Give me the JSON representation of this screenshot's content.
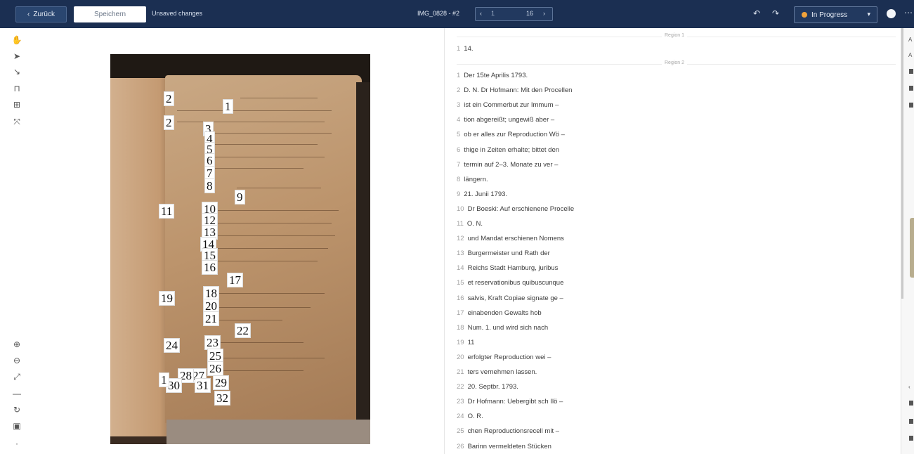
{
  "topbar": {
    "back_label": "Zurück",
    "save_label": "Speichern",
    "unsaved_text": "Unsaved changes",
    "doc_title": "IMG_0828 - #2",
    "pager_prev": "‹",
    "pager_page": "1",
    "pager_total": "16",
    "pager_next": "›",
    "status_label": "In Progress"
  },
  "canvas": {
    "region_numbers": [
      "1",
      "2",
      "2",
      "3",
      "4",
      "5",
      "6",
      "7",
      "8",
      "9",
      "10",
      "11",
      "12",
      "13",
      "14",
      "15",
      "16",
      "17",
      "18",
      "19",
      "20",
      "21",
      "22",
      "23",
      "24",
      "25",
      "26",
      "27",
      "28",
      "29",
      "30",
      "31",
      "32",
      "1"
    ]
  },
  "transcript": {
    "region1_label": "Region 1",
    "region2_label": "Region 2",
    "region1_lines": [
      {
        "n": "1",
        "text": "14."
      }
    ],
    "region2_lines": [
      {
        "n": "1",
        "text": "Der 15te Aprilis 1793."
      },
      {
        "n": "2",
        "text": "D. N. Dr Hofmann: Mit den Procellen"
      },
      {
        "n": "3",
        "text": "ist ein Commerbut zur Immum –"
      },
      {
        "n": "4",
        "text": "tion abgereißt; ungewiß aber –"
      },
      {
        "n": "5",
        "text": "ob er alles zur Reproduction Wö –"
      },
      {
        "n": "6",
        "text": "thige in Zeiten erhalte; bittet den"
      },
      {
        "n": "7",
        "text": "termin auf 2–3. Monate zu ver –"
      },
      {
        "n": "8",
        "text": "längern."
      },
      {
        "n": "9",
        "text": "21. Junii 1793."
      },
      {
        "n": "10",
        "text": "Dr Boeski: Auf erschienene Procelle"
      },
      {
        "n": "11",
        "text": "O. N."
      },
      {
        "n": "12",
        "text": "und Mandat erschienen Nomens"
      },
      {
        "n": "13",
        "text": "Burgermeister und Rath der"
      },
      {
        "n": "14",
        "text": "Reichs Stadt Hamburg, juribus"
      },
      {
        "n": "15",
        "text": "et reservationibus quibuscunque"
      },
      {
        "n": "16",
        "text": "salvis, Kraft Copiae signate ge –"
      },
      {
        "n": "17",
        "text": "einabenden Gewalts hob"
      },
      {
        "n": "18",
        "text": "Num. 1. und wird sich nach"
      },
      {
        "n": "19",
        "text": "11"
      },
      {
        "n": "20",
        "text": "erfolgter Reproduction wei –"
      },
      {
        "n": "21",
        "text": "ters vernehmen lassen."
      },
      {
        "n": "22",
        "text": "20. Septbr. 1793."
      },
      {
        "n": "23",
        "text": "Dr Hofmann: Uebergibt sch Ilö –"
      },
      {
        "n": "24",
        "text": "O. R."
      },
      {
        "n": "25",
        "text": "chen Reproductionsrecell mit –"
      },
      {
        "n": "26",
        "text": "Barinn vermeldeten Stücken"
      }
    ]
  },
  "colors": {
    "topbar_bg": "#1b2f52",
    "status_dot": "#f1a33b"
  }
}
